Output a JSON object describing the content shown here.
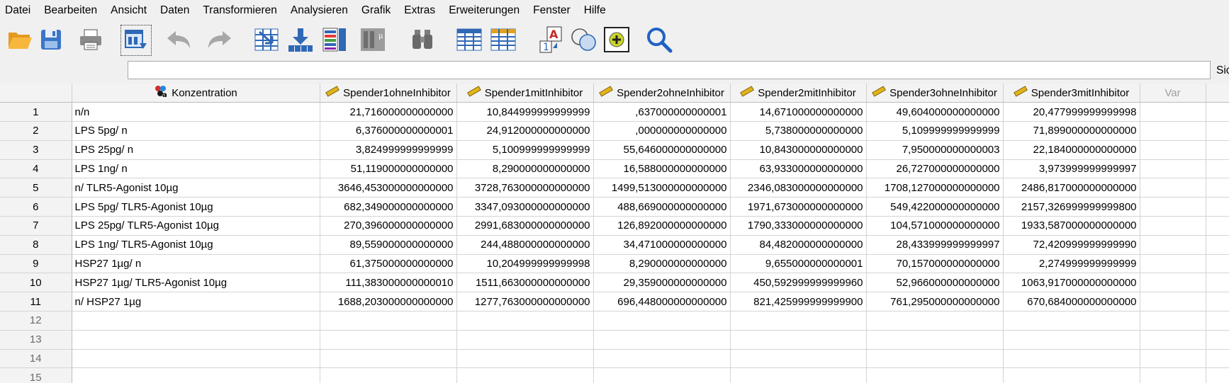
{
  "menu": [
    "Datei",
    "Bearbeiten",
    "Ansicht",
    "Daten",
    "Transformieren",
    "Analysieren",
    "Grafik",
    "Extras",
    "Erweiterungen",
    "Fenster",
    "Hilfe"
  ],
  "toolbar_icons": [
    "open-folder-icon",
    "save-icon",
    "print-icon",
    "dialog-recall-icon",
    "undo-icon",
    "redo-icon",
    "goto-case-icon",
    "goto-variable-icon",
    "variables-icon",
    "run-descriptive-icon",
    "find-icon",
    "insert-cases-icon",
    "insert-variable-icon",
    "split-file-icon",
    "select-cases-icon",
    "value-labels-icon",
    "use-sets-icon",
    "search-icon"
  ],
  "input_bar": {
    "value": "",
    "visible_label": "Sic"
  },
  "grid": {
    "columns": [
      "Konzentration",
      "Spender1ohneInhibitor",
      "Spender1mitInhibitor",
      "Spender2ohneInhibitor",
      "Spender2mitInhibitor",
      "Spender3ohneInhibitor",
      "Spender3mitInhibitor",
      "Var"
    ],
    "rows": [
      {
        "n": "1",
        "cells": [
          "n/n",
          "21,716000000000000",
          "10,844999999999999",
          ",637000000000001",
          "14,671000000000000",
          "49,604000000000000",
          "20,477999999999998"
        ]
      },
      {
        "n": "2",
        "cells": [
          "LPS 5pg/ n",
          "6,376000000000001",
          "24,912000000000000",
          ",000000000000000",
          "5,738000000000000",
          "5,109999999999999",
          "71,899000000000000"
        ]
      },
      {
        "n": "3",
        "cells": [
          "LPS 25pg/ n",
          "3,824999999999999",
          "5,100999999999999",
          "55,646000000000000",
          "10,843000000000000",
          "7,950000000000003",
          "22,184000000000000"
        ]
      },
      {
        "n": "4",
        "cells": [
          "LPS 1ng/ n",
          "51,119000000000000",
          "8,290000000000000",
          "16,588000000000000",
          "63,933000000000000",
          "26,727000000000000",
          "3,973999999999997"
        ]
      },
      {
        "n": "5",
        "cells": [
          "n/ TLR5-Agonist 10µg",
          "3646,453000000000000",
          "3728,763000000000000",
          "1499,513000000000000",
          "2346,083000000000000",
          "1708,127000000000000",
          "2486,817000000000000"
        ]
      },
      {
        "n": "6",
        "cells": [
          "LPS 5pg/ TLR5-Agonist 10µg",
          "682,349000000000000",
          "3347,093000000000000",
          "488,669000000000000",
          "1971,673000000000000",
          "549,422000000000000",
          "2157,326999999999800"
        ]
      },
      {
        "n": "7",
        "cells": [
          "LPS 25pg/ TLR5-Agonist 10µg",
          "270,396000000000000",
          "2991,683000000000000",
          "126,892000000000000",
          "1790,333000000000000",
          "104,571000000000000",
          "1933,587000000000000"
        ]
      },
      {
        "n": "8",
        "cells": [
          "LPS 1ng/ TLR5-Agonist 10µg",
          "89,559000000000000",
          "244,488000000000000",
          "34,471000000000000",
          "84,482000000000000",
          "28,433999999999997",
          "72,420999999999990"
        ]
      },
      {
        "n": "9",
        "cells": [
          "HSP27 1µg/ n",
          "61,375000000000000",
          "10,204999999999998",
          "8,290000000000000",
          "9,655000000000001",
          "70,157000000000000",
          "2,274999999999999"
        ]
      },
      {
        "n": "10",
        "cells": [
          "HSP27 1µg/ TLR5-Agonist 10µg",
          "111,383000000000010",
          "1511,663000000000000",
          "29,359000000000000",
          "450,592999999999960",
          "52,966000000000000",
          "1063,917000000000000"
        ]
      },
      {
        "n": "11",
        "cells": [
          "n/ HSP27 1µg",
          "1688,203000000000000",
          "1277,763000000000000",
          "696,448000000000000",
          "821,425999999999900",
          "761,295000000000000",
          "670,684000000000000"
        ]
      }
    ],
    "empty_rows": [
      "12",
      "13",
      "14",
      "15"
    ]
  }
}
